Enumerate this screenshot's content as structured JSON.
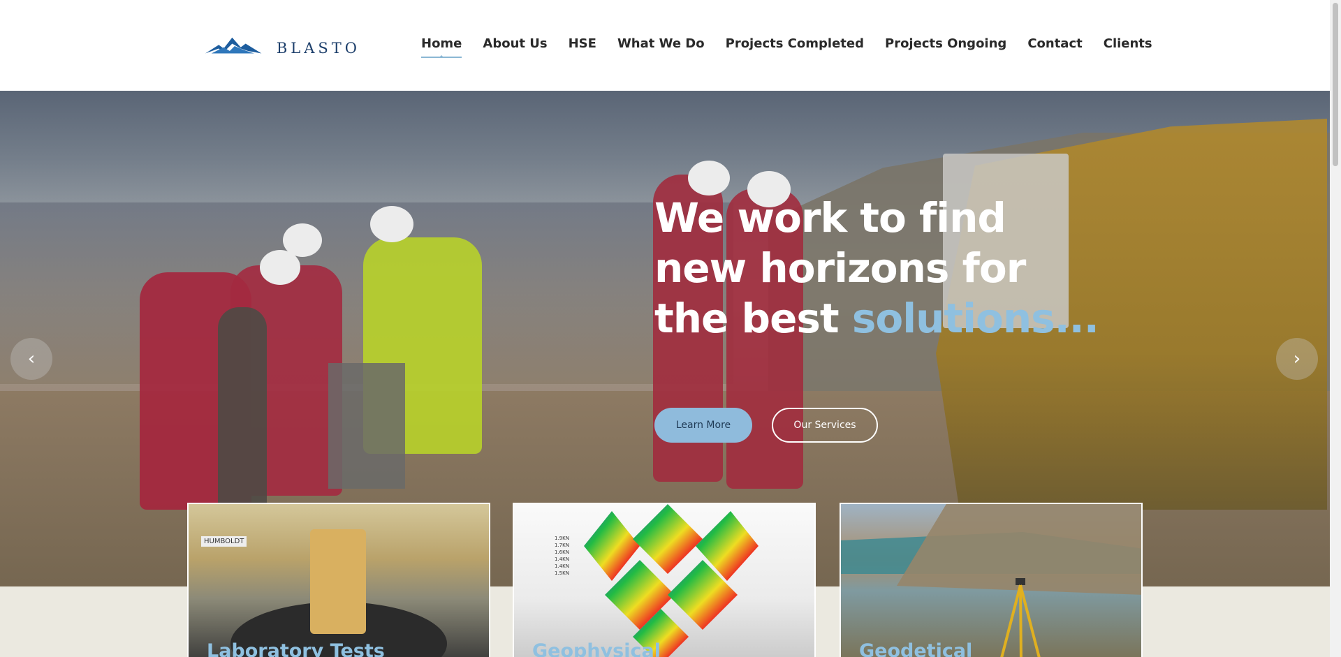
{
  "brand": {
    "name": "BLASTO",
    "logo_color": "#1d5d9e"
  },
  "nav": {
    "items": [
      {
        "label": "Home",
        "active": true
      },
      {
        "label": "About Us",
        "active": false
      },
      {
        "label": "HSE",
        "active": false
      },
      {
        "label": "What We Do",
        "active": false
      },
      {
        "label": "Projects Completed",
        "active": false
      },
      {
        "label": "Projects Ongoing",
        "active": false
      },
      {
        "label": "Contact",
        "active": false
      },
      {
        "label": "Clients",
        "active": false
      }
    ],
    "accent_color": "#8bb7d4"
  },
  "hero": {
    "title_line1": "We work to find",
    "title_line2": "new horizons for",
    "title_line3_prefix": "the best ",
    "title_line3_accent": "solutions...",
    "learn_more_label": "Learn More",
    "services_label": "Our Services",
    "prev_icon": "‹",
    "next_icon": "›"
  },
  "cards": [
    {
      "title": "Laboratory Tests",
      "image_label": "HUMBOLDT"
    },
    {
      "title": "Geophysical",
      "axis_values": "1.9KN\n1.7KN\n1.6KN\n1.4KN\n1.4KN\n1.5KN"
    },
    {
      "title": "Geodetical"
    }
  ],
  "colors": {
    "accent": "#8fc0e0",
    "page_bg": "#ebe9e0"
  }
}
